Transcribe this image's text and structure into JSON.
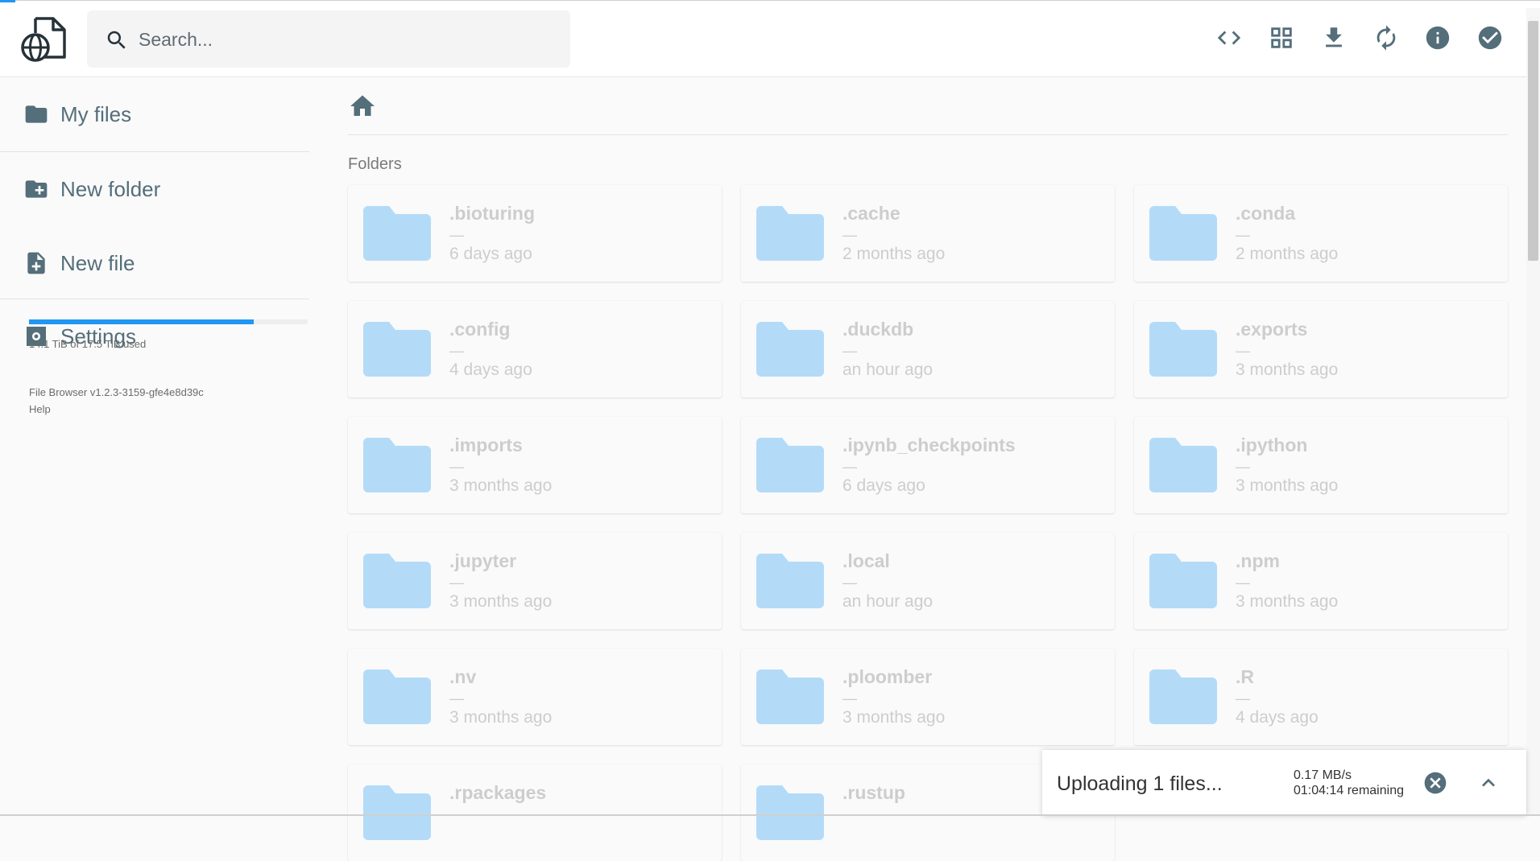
{
  "search": {
    "placeholder": "Search..."
  },
  "header": {
    "actions": [
      {
        "icon": "code-icon",
        "label": "Toggle code view"
      },
      {
        "icon": "grid-view-icon",
        "label": "Switch view"
      },
      {
        "icon": "download-icon",
        "label": "Download"
      },
      {
        "icon": "refresh-icon",
        "label": "Refresh"
      },
      {
        "icon": "info-icon",
        "label": "Info"
      },
      {
        "icon": "check-circle-icon",
        "label": "Select"
      }
    ]
  },
  "sidebar": {
    "items": [
      {
        "label": "My files",
        "icon": "folder-icon"
      },
      {
        "label": "New folder",
        "icon": "create-folder-icon"
      },
      {
        "label": "New file",
        "icon": "note-add-icon"
      },
      {
        "label": "Settings",
        "icon": "settings-icon"
      }
    ],
    "usage": {
      "text": "14.1 TiB of 17.5 TiB used",
      "fraction": 0.806
    },
    "version": "File Browser v1.2.3-3159-gfe4e8d39c",
    "help": "Help"
  },
  "main": {
    "folders_heading": "Folders",
    "folders": [
      {
        "name": ".bioturing",
        "size": "—",
        "modified": "6 days ago"
      },
      {
        "name": ".cache",
        "size": "—",
        "modified": "2 months ago"
      },
      {
        "name": ".conda",
        "size": "—",
        "modified": "2 months ago"
      },
      {
        "name": ".config",
        "size": "—",
        "modified": "4 days ago"
      },
      {
        "name": ".duckdb",
        "size": "—",
        "modified": "an hour ago"
      },
      {
        "name": ".exports",
        "size": "—",
        "modified": "3 months ago"
      },
      {
        "name": ".imports",
        "size": "—",
        "modified": "3 months ago"
      },
      {
        "name": ".ipynb_checkpoints",
        "size": "—",
        "modified": "6 days ago"
      },
      {
        "name": ".ipython",
        "size": "—",
        "modified": "3 months ago"
      },
      {
        "name": ".jupyter",
        "size": "—",
        "modified": "3 months ago"
      },
      {
        "name": ".local",
        "size": "—",
        "modified": "an hour ago"
      },
      {
        "name": ".npm",
        "size": "—",
        "modified": "3 months ago"
      },
      {
        "name": ".nv",
        "size": "—",
        "modified": "3 months ago"
      },
      {
        "name": ".ploomber",
        "size": "—",
        "modified": "3 months ago"
      },
      {
        "name": ".R",
        "size": "—",
        "modified": "4 days ago"
      },
      {
        "name": ".rpackages",
        "size": "—",
        "modified": ""
      },
      {
        "name": ".rustup",
        "size": "—",
        "modified": ""
      }
    ]
  },
  "upload": {
    "title": "Uploading 1 files...",
    "speed": "0.17 MB/s",
    "remaining": "01:04:14 remaining"
  },
  "colors": {
    "accent": "#2196f3",
    "folder": "#b3dbf8",
    "icon": "#546e7a"
  }
}
